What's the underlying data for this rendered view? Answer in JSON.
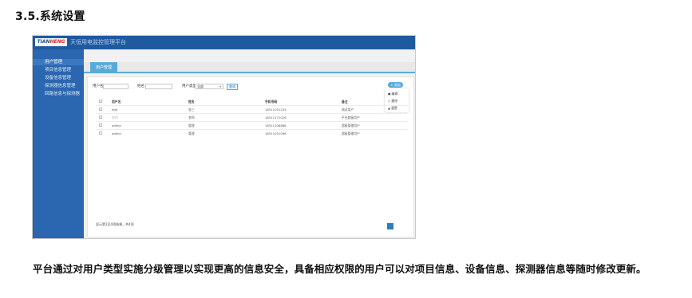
{
  "doc": {
    "heading": "3.5.系统设置",
    "caption": "平台通过对用户类型实施分级管理以实现更高的信息安全，具备相应权限的用户可以对项目信息、设备信息、探测器信息等随时修改更新。"
  },
  "app": {
    "logo_a": "TIAN",
    "logo_b": "HENG",
    "title": "天恒用电监控管理平台"
  },
  "sidebar": {
    "items": [
      {
        "label": "用户管理"
      },
      {
        "label": "项目信息管理"
      },
      {
        "label": "设备信息管理"
      },
      {
        "label": "探测器信息管理"
      },
      {
        "label": "回路信息与探测器"
      }
    ]
  },
  "main": {
    "tab_label": "用户管理",
    "filters": {
      "username_label": "用户名",
      "name_label": "姓名",
      "type_label": "用户类型",
      "type_value": "全部",
      "query_label": "查询"
    },
    "add_button": "+ 添加",
    "menu_items": [
      "● 编辑",
      "○ 删除",
      "▲ 重置"
    ],
    "columns": [
      "用户名",
      "姓名",
      "手机号码",
      "备注"
    ],
    "rows": [
      {
        "username": "test",
        "name": "张三",
        "phone": "18511051234",
        "note": "测试用户",
        "faint": false
      },
      {
        "username": "李四",
        "name": "李四",
        "phone": "18511171026",
        "note": "平台超级用户",
        "faint": true
      },
      {
        "username": "admin",
        "name": "管理",
        "phone": "18511208888",
        "note": "超级管理用户",
        "faint": false
      },
      {
        "username": "admin",
        "name": "管理",
        "phone": "18511051098",
        "note": "超级管理用户",
        "faint": false
      }
    ],
    "footer": "显示第1至4项结果，共4项"
  },
  "colors": {
    "header": "#1f5aa0",
    "sidebar": "#2a67b0",
    "accent": "#5aaad9"
  }
}
